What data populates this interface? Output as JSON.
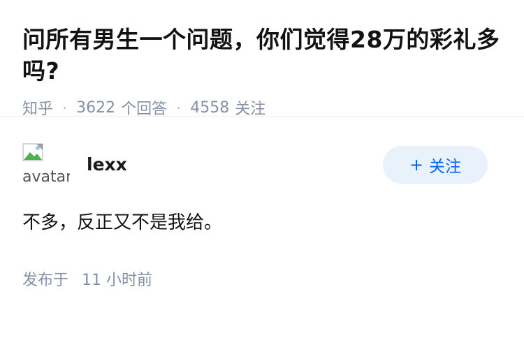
{
  "question": {
    "title": "问所有男生一个问题，你们觉得28万的彩礼多吗?",
    "source": "知乎",
    "answer_count": "3622",
    "answer_label": "个回答",
    "follower_count": "4558",
    "follower_label": "关注"
  },
  "answer": {
    "avatar_alt": "avatar",
    "author_name": "lexx",
    "follow_label": "关注",
    "follow_prefix": "+",
    "content": "不多，反正又不是我给。",
    "time_prefix": "发布于",
    "time_value": "11 小时前"
  }
}
